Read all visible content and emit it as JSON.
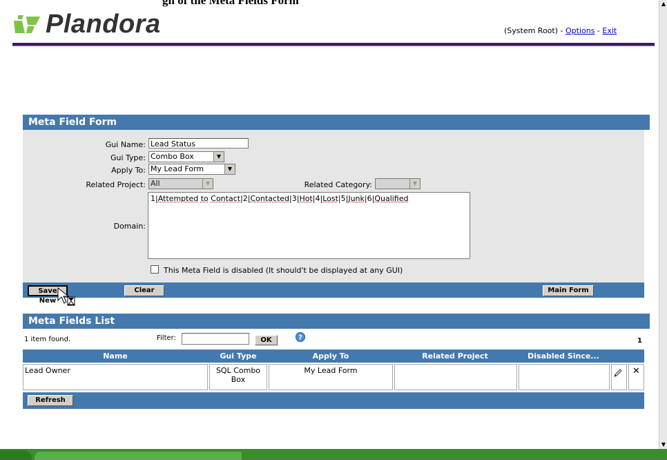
{
  "page": {
    "cut_heading": "gn of the Meta Fields Form"
  },
  "header": {
    "logo_text": "Plandora",
    "context": "(System Root) - ",
    "options_link": "Options",
    "separator": " - ",
    "exit_link": "Exit"
  },
  "meta_form": {
    "title": "Meta Field Form",
    "gui_name_label": "Gui Name:",
    "gui_name_value": "Lead Status",
    "gui_type_label": "Gui Type:",
    "gui_type_value": "Combo Box",
    "apply_to_label": "Apply To:",
    "apply_to_value": "My Lead Form",
    "related_project_label": "Related Project:",
    "related_project_value": "All",
    "related_category_label": "Related Category:",
    "related_category_value": "",
    "domain_label": "Domain:",
    "domain_parts": [
      "1|",
      "Attempted",
      " ",
      "to",
      " ",
      "Contact",
      "|2|",
      "Contacted",
      "|3|",
      "Hot",
      "|4|",
      "Lost",
      "|5|",
      "Junk",
      "|6|",
      "Qualified"
    ],
    "disabled_checkbox_label": "This Meta Field is disabled (It should't be displayed at any GUI)",
    "disabled_checked": false,
    "save_button": "Save New",
    "clear_button": "Clear",
    "main_form_button": "Main Form"
  },
  "meta_list": {
    "title": "Meta Fields List",
    "items_found": "1 item found.",
    "filter_label": "Filter:",
    "filter_value": "",
    "ok_button": "OK",
    "page_number": "1",
    "columns": [
      "Name",
      "Gui Type",
      "Apply To",
      "Related Project",
      "Disabled Since..."
    ],
    "rows": [
      {
        "name": "Lead Owner",
        "gui_type": "SQL Combo Box",
        "apply_to": "My Lead Form",
        "related_project": "",
        "disabled_since": ""
      }
    ],
    "refresh_button": "Refresh"
  },
  "colors": {
    "panel_bar": "#4479ad",
    "form_bg": "#e6e6e6",
    "header_line": "#3a1f5c",
    "taskbar": "#3c8b2e"
  },
  "icons": [
    "logo-icon",
    "help-icon",
    "edit-pencil-icon",
    "delete-x-icon",
    "hourglass-cursor-icon",
    "scroll-up-icon",
    "scroll-down-icon"
  ]
}
